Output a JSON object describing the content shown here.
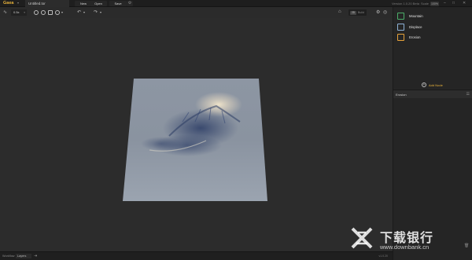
{
  "app": {
    "brand": "Gaea",
    "file_tab": "Untitled.tor"
  },
  "menu": {
    "new": "New",
    "open": "Open",
    "save": "Save"
  },
  "titlebar_right": {
    "version": "Version 1.0.20 Beta",
    "scale_label": "Scale",
    "scale_value": "100%"
  },
  "toolbar": {
    "zoom": "0.5x",
    "view_mode_a": "2D",
    "view_mode_b": "Build"
  },
  "nodes": [
    {
      "label": "Mountain",
      "color": "#4caf6a"
    },
    {
      "label": "Displace",
      "color": "#8fb3d8"
    },
    {
      "label": "Erosion",
      "color": "#e8a33a"
    }
  ],
  "add_node": "Add Node",
  "properties": {
    "title": "Erosion"
  },
  "statusbar": {
    "label": "Workflow",
    "value": "Layers",
    "right": "v1.0.20"
  },
  "watermark": {
    "title": "下载银行",
    "url": "www.downbank.cn"
  },
  "colors": {
    "accent": "#e8b23a",
    "bg": "#2b2b2b",
    "panel": "#252525"
  }
}
